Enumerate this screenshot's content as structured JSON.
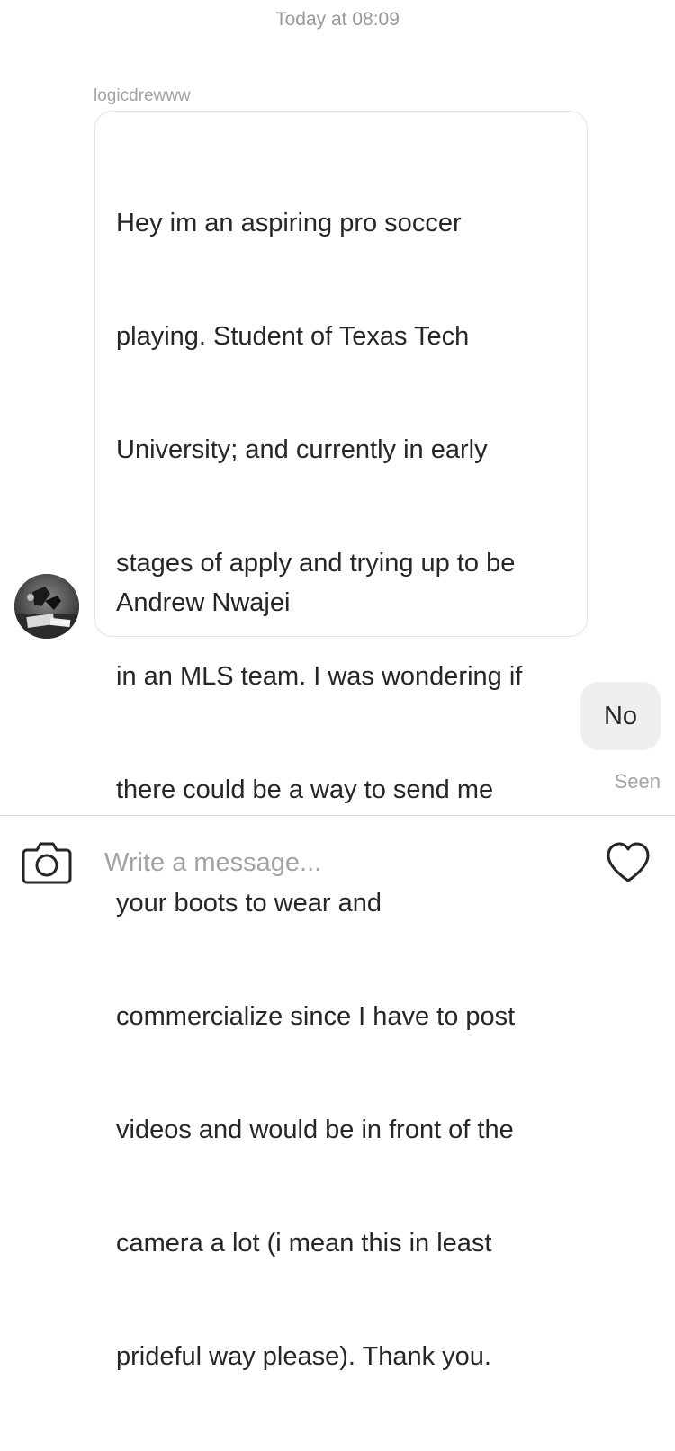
{
  "thread": {
    "timestamp": "Today at 08:09"
  },
  "incoming_message": {
    "sender": "logicdrewww",
    "lines": [
      "Hey im an aspiring pro soccer",
      "playing. Student of Texas Tech",
      "University; and currently in early",
      "stages of apply and trying up to be",
      "in an MLS team. I was wondering if",
      "there could be a way to send me",
      "your boots to wear and",
      "commercialize since I have to post",
      "videos and would be in front of the",
      "camera a lot (i mean this in least",
      "prideful way please). Thank you."
    ],
    "signature": "Andrew Nwajei",
    "avatar_icon": "user-avatar"
  },
  "outgoing_message": {
    "text": "No",
    "status": "Seen"
  },
  "composer": {
    "placeholder": "Write a message...",
    "value": "",
    "camera_icon": "camera-icon",
    "heart_icon": "heart-icon"
  },
  "colors": {
    "meta_text": "#999999",
    "body_text": "#262626",
    "outgoing_bubble": "#efefef",
    "bubble_border": "#e3e3e3",
    "divider": "#dbdbdb"
  }
}
